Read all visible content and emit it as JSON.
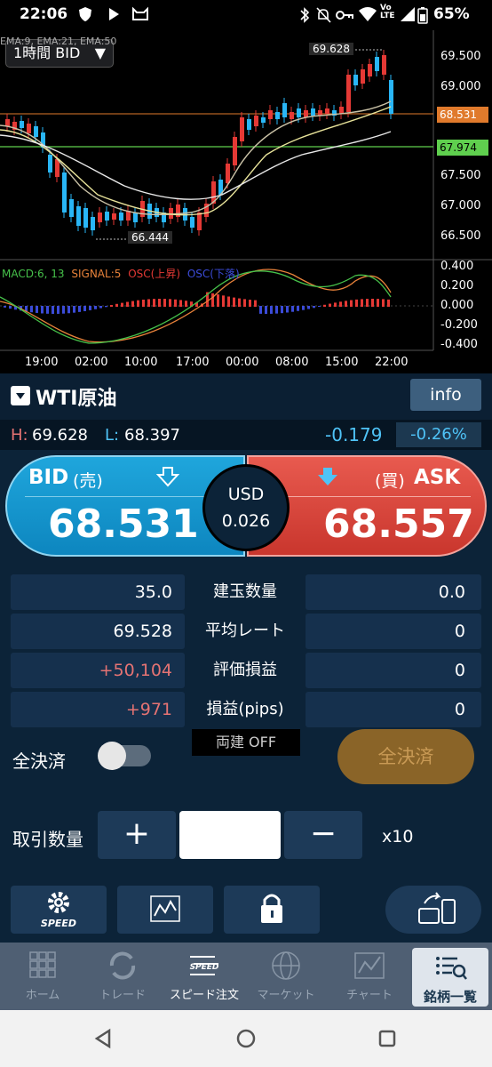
{
  "status": {
    "time": "22:06",
    "battery": "65%"
  },
  "chart": {
    "timeframe": "1時間 BID",
    "ema_legend": "EMA:9, EMA:21, EMA:50",
    "high_label": "69.628",
    "low_label": "66.444",
    "price_ticks": [
      "69.500",
      "69.000",
      "68.500",
      "68.000",
      "67.500",
      "67.000",
      "66.500"
    ],
    "current_price_tag": "68.531",
    "line_tag": "67.974",
    "macd_legend": {
      "macd": "MACD:6, 13",
      "signal": "SIGNAL:5",
      "osc_up": "OSC(上昇)",
      "osc_down": "OSC(下落)"
    },
    "osc_ticks": [
      "0.400",
      "0.200",
      "0.000",
      "-0.200",
      "-0.400"
    ],
    "time_ticks": [
      "19:00",
      "02:00",
      "10:00",
      "17:00",
      "00:00",
      "08:00",
      "15:00",
      "22:00"
    ]
  },
  "symbol": {
    "name": "WTI原油",
    "info_label": "info"
  },
  "hl": {
    "h_label": "H:",
    "h_value": "69.628",
    "l_label": "L:",
    "l_value": "68.397",
    "change": "-0.179",
    "change_pct": "-0.26%"
  },
  "quote": {
    "bid_label": "BID",
    "bid_sub": "(売)",
    "bid": "68.531",
    "ask_label": "ASK",
    "ask_sub": "(買)",
    "ask": "68.557",
    "spread_ccy": "USD",
    "spread": "0.026"
  },
  "positions": [
    {
      "left": "35.0",
      "label": "建玉数量",
      "right": "0.0"
    },
    {
      "left": "69.528",
      "label": "平均レート",
      "right": "0"
    },
    {
      "left": "+50,104",
      "label": "評価損益",
      "right": "0"
    },
    {
      "left": "+971",
      "label": "損益(pips)",
      "right": "0"
    }
  ],
  "controls": {
    "close_all_label": "全決済",
    "hedge_label": "両建 OFF",
    "close_all_button": "全決済",
    "qty_label": "取引数量",
    "plus": "+",
    "minus": "−",
    "qty_value": "",
    "multiplier": "x10"
  },
  "toolbar": {
    "speed_label": "SPEED"
  },
  "nav": [
    {
      "label": "ホーム"
    },
    {
      "label": "トレード"
    },
    {
      "label": "スピード注文"
    },
    {
      "label": "マーケット"
    },
    {
      "label": "チャート"
    },
    {
      "label": "銘柄一覧"
    }
  ],
  "nav_speed_icon_text": "SPEED"
}
